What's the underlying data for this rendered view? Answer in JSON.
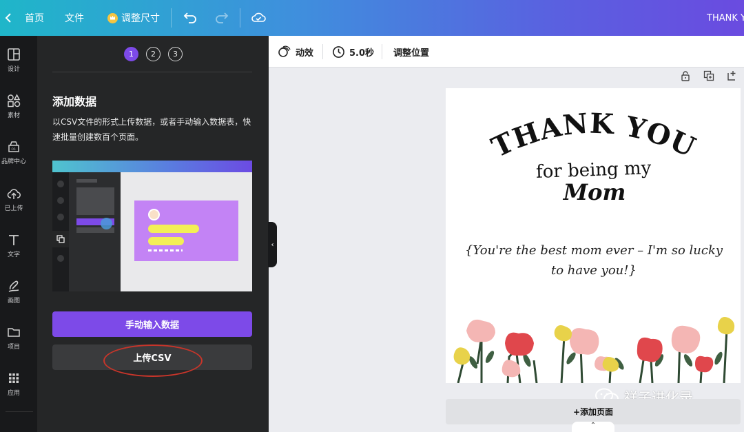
{
  "topbar": {
    "home_label": "首页",
    "file_label": "文件",
    "resize_label": "调整尺寸",
    "title_truncated": "THANK Y"
  },
  "rail": {
    "items": [
      {
        "label": "设计",
        "icon": "layout-icon"
      },
      {
        "label": "素材",
        "icon": "shapes-icon"
      },
      {
        "label": "品牌中心",
        "icon": "brand-icon"
      },
      {
        "label": "已上传",
        "icon": "cloud-upload-icon"
      },
      {
        "label": "文字",
        "icon": "text-icon"
      },
      {
        "label": "画图",
        "icon": "draw-icon"
      },
      {
        "label": "项目",
        "icon": "folder-icon"
      },
      {
        "label": "应用",
        "icon": "apps-icon"
      }
    ]
  },
  "panel": {
    "steps": [
      "1",
      "2",
      "3"
    ],
    "active_step": "1",
    "title": "添加数据",
    "description": "以CSV文件的形式上传数据，或者手动输入数据表，快速批量创建数百个页面。",
    "manual_button": "手动输入数据",
    "upload_button": "上传CSV"
  },
  "toolbar": {
    "animate_label": "动效",
    "duration_label": "5.0秒",
    "position_label": "调整位置"
  },
  "card": {
    "line1": "THANK YOU",
    "line2": "for being my",
    "line3": "Mom",
    "message_line1": "{You're the best mom ever – I'm so lucky",
    "message_line2": "to have you!}"
  },
  "add_page_label": "+添加页面",
  "watermark_text": "祥子进化录",
  "colors": {
    "accent": "#7d4ae8",
    "annotation_red": "#c8352a",
    "flower_pink": "#f4b6b4",
    "flower_red": "#e0474c",
    "flower_yellow": "#e8d24a",
    "stem_green": "#2f4a33"
  }
}
